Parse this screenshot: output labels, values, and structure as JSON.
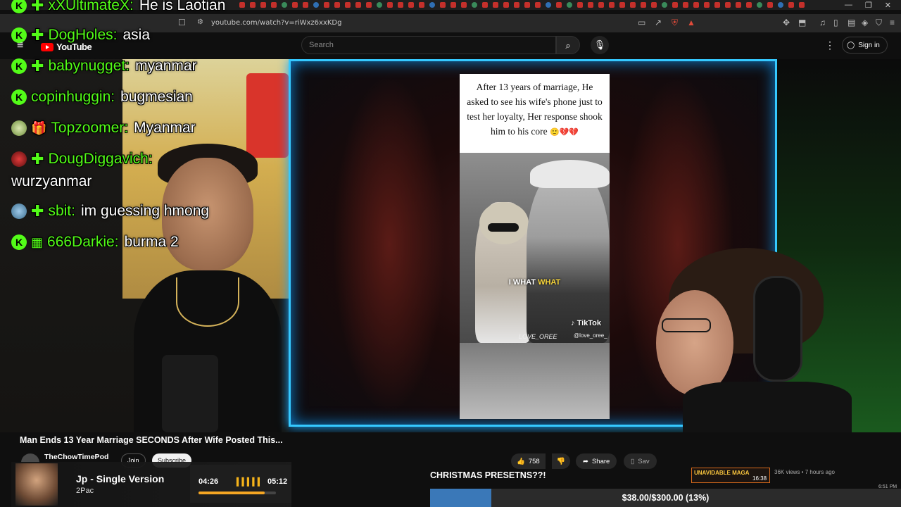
{
  "browser": {
    "url": "youtube.com/watch?v=riWxz6xxKDg"
  },
  "youtube": {
    "logo_text": "YouTube",
    "search_placeholder": "Search",
    "signin_label": "Sign in"
  },
  "chat": [
    {
      "user": "xXUltimateX",
      "message": "He is Laotian",
      "badge": "plus"
    },
    {
      "user": "DogHoles",
      "message": "asia",
      "badge": "plus"
    },
    {
      "user": "babynugget",
      "message": "myanmar",
      "badge": "plus"
    },
    {
      "user": "copinhuggin",
      "message": "bugmesian",
      "badge": "none"
    },
    {
      "user": "Topzoomer",
      "message": "Myanmar",
      "badge": "gift"
    },
    {
      "user": "DougDiggavich",
      "message": "wurzyanmar",
      "badge": "plus"
    },
    {
      "user": "sbit",
      "message": "im guessing hmong",
      "badge": "plus"
    },
    {
      "user": "666Darkie",
      "message": "burma 2",
      "badge": "gift"
    }
  ],
  "video": {
    "caption": "After 13 years of marriage, He asked to see his wife's phone just to test her loyalty, Her response shook him to his core",
    "caption_emoji": "🙂💔💔",
    "subtitle_white": "I WHAT",
    "subtitle_yellow": "WHAT",
    "tiktok_logo": "TikTok",
    "tiktok_handle": "@love_oree_",
    "watermark": "LOVE_OREE",
    "title": "Man Ends 13 Year Marriage SECONDS After Wife Posted This..."
  },
  "channel": {
    "name": "TheChowTimePod",
    "join_label": "Join",
    "subscribe_label": "Subscribe"
  },
  "actions": {
    "like_count": "758",
    "share_label": "Share",
    "save_label": "Sav"
  },
  "meta": {
    "views": "36K views • 7 hours ago",
    "clock": "6:51 PM"
  },
  "now_playing": {
    "title": "Jp - Single Version",
    "artist": "2Pac",
    "current_time": "04:26",
    "total_time": "05:12",
    "progress": 0.85
  },
  "goal": {
    "title": "CHRISTMAS PRESETNS??!",
    "text": "$38.00/$300.00 (13%)",
    "fraction": 0.13
  },
  "widget": {
    "label": "UNAVIDABLE MAGA",
    "time": "16:38"
  },
  "colors": {
    "chat_username": "#53fc18",
    "frame_glow": "#35c9ff",
    "goal_fill": "#3a78b8",
    "progress_fill": "#f5a623"
  }
}
